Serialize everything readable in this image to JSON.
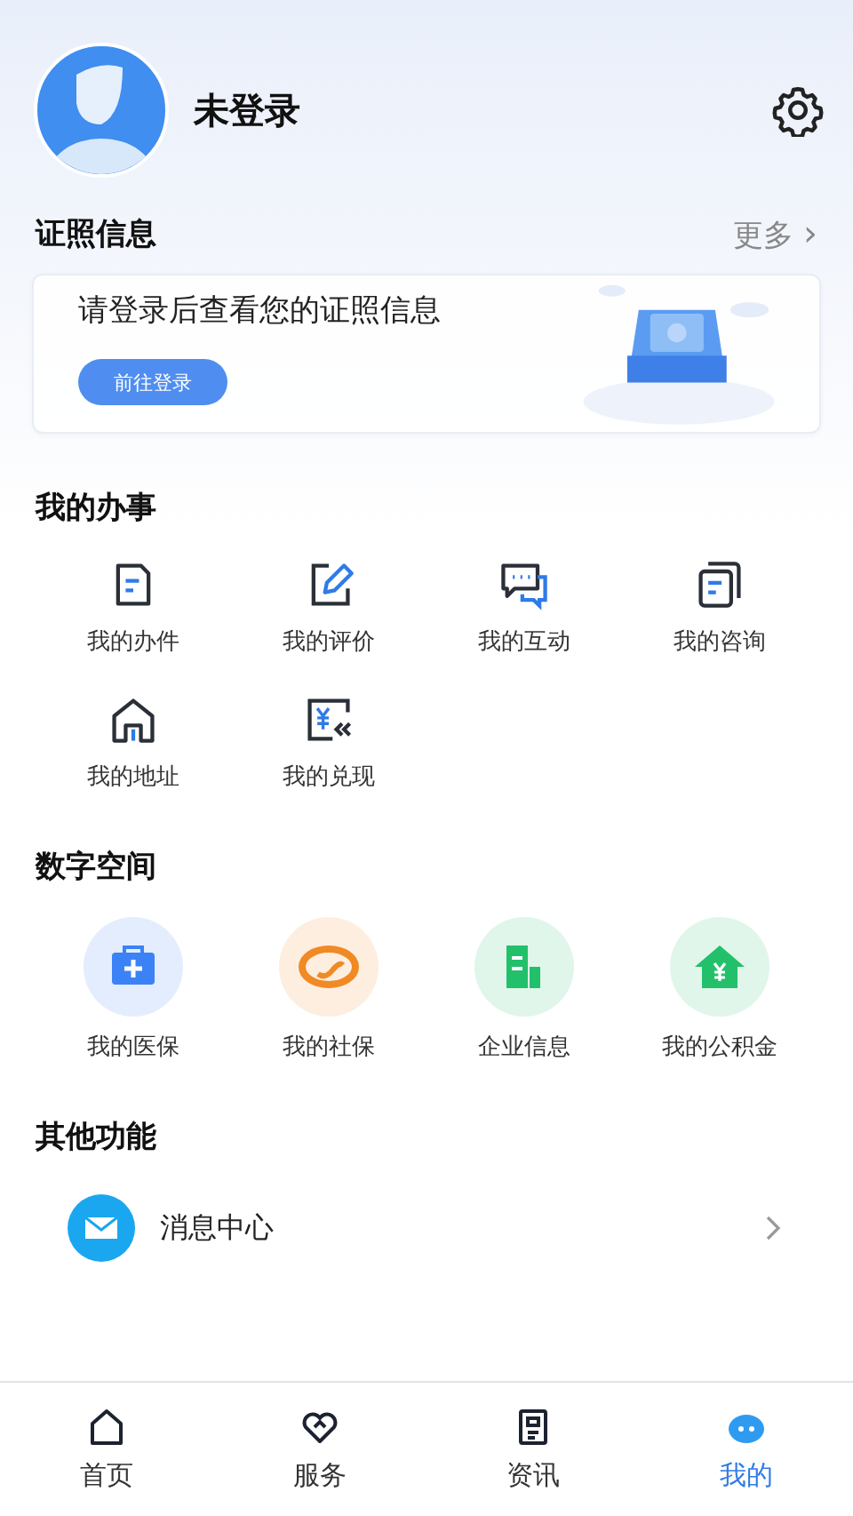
{
  "profile": {
    "name": "未登录"
  },
  "license": {
    "title": "证照信息",
    "more": "更多",
    "more_arrow": "›",
    "message": "请登录后查看您的证照信息",
    "button": "前往登录"
  },
  "affairs": {
    "title": "我的办事",
    "items": [
      {
        "label": "我的办件",
        "kind": "doc"
      },
      {
        "label": "我的评价",
        "kind": "edit"
      },
      {
        "label": "我的互动",
        "kind": "chat"
      },
      {
        "label": "我的咨询",
        "kind": "docs"
      },
      {
        "label": "我的地址",
        "kind": "house"
      },
      {
        "label": "我的兑现",
        "kind": "cash"
      }
    ]
  },
  "space": {
    "title": "数字空间",
    "items": [
      {
        "label": "我的医保",
        "kind": "medical",
        "color": "#3b82f6"
      },
      {
        "label": "我的社保",
        "kind": "social",
        "color": "#f08a24"
      },
      {
        "label": "企业信息",
        "kind": "company",
        "color": "#22c06a"
      },
      {
        "label": "我的公积金",
        "kind": "fund",
        "color": "#22c06a"
      }
    ]
  },
  "other": {
    "title": "其他功能",
    "items": [
      {
        "label": "消息中心"
      }
    ]
  },
  "tabs": [
    {
      "label": "首页",
      "kind": "home",
      "selected": false
    },
    {
      "label": "服务",
      "kind": "service",
      "selected": false
    },
    {
      "label": "资讯",
      "kind": "news",
      "selected": false
    },
    {
      "label": "我的",
      "kind": "mine",
      "selected": true
    }
  ]
}
